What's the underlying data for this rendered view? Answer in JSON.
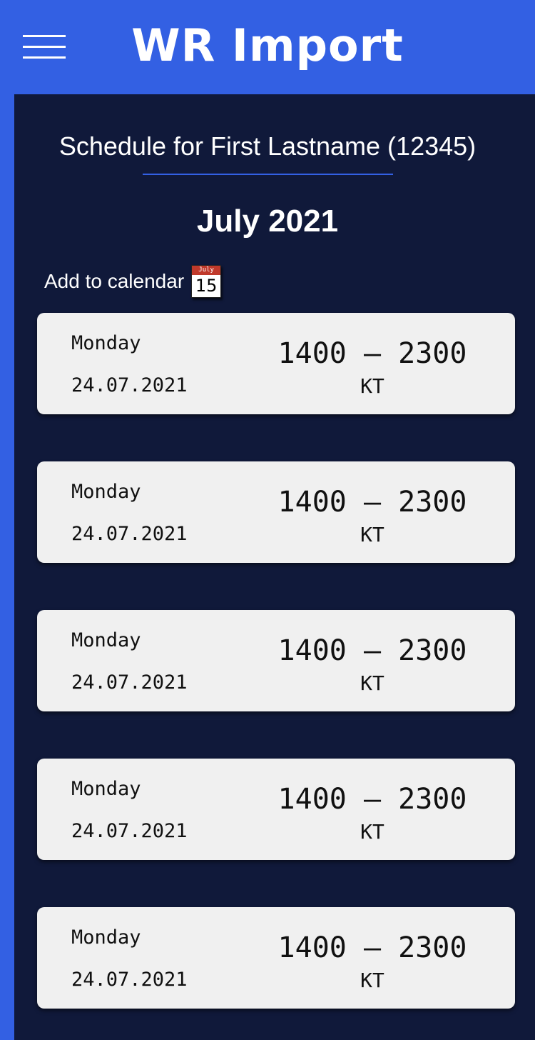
{
  "header": {
    "menu_icon": "hamburger-menu-icon",
    "title": "WR Import"
  },
  "main": {
    "schedule_title": "Schedule for First Lastname (12345)",
    "month": "July 2021",
    "add_to_calendar": {
      "label": "Add to calendar",
      "icon": "calendar-icon",
      "icon_month": "July",
      "icon_day": "15"
    },
    "shifts": [
      {
        "day": "Monday",
        "date": "24.07.2021",
        "time": "1400 – 2300",
        "code": "KT"
      },
      {
        "day": "Monday",
        "date": "24.07.2021",
        "time": "1400 – 2300",
        "code": "KT"
      },
      {
        "day": "Monday",
        "date": "24.07.2021",
        "time": "1400 – 2300",
        "code": "KT"
      },
      {
        "day": "Monday",
        "date": "24.07.2021",
        "time": "1400 – 2300",
        "code": "KT"
      },
      {
        "day": "Monday",
        "date": "24.07.2021",
        "time": "1400 – 2300",
        "code": "KT"
      }
    ]
  },
  "colors": {
    "accent": "#3360e3",
    "background": "#10193a",
    "card": "#f0f0f0",
    "calendar_red": "#c0392b"
  }
}
